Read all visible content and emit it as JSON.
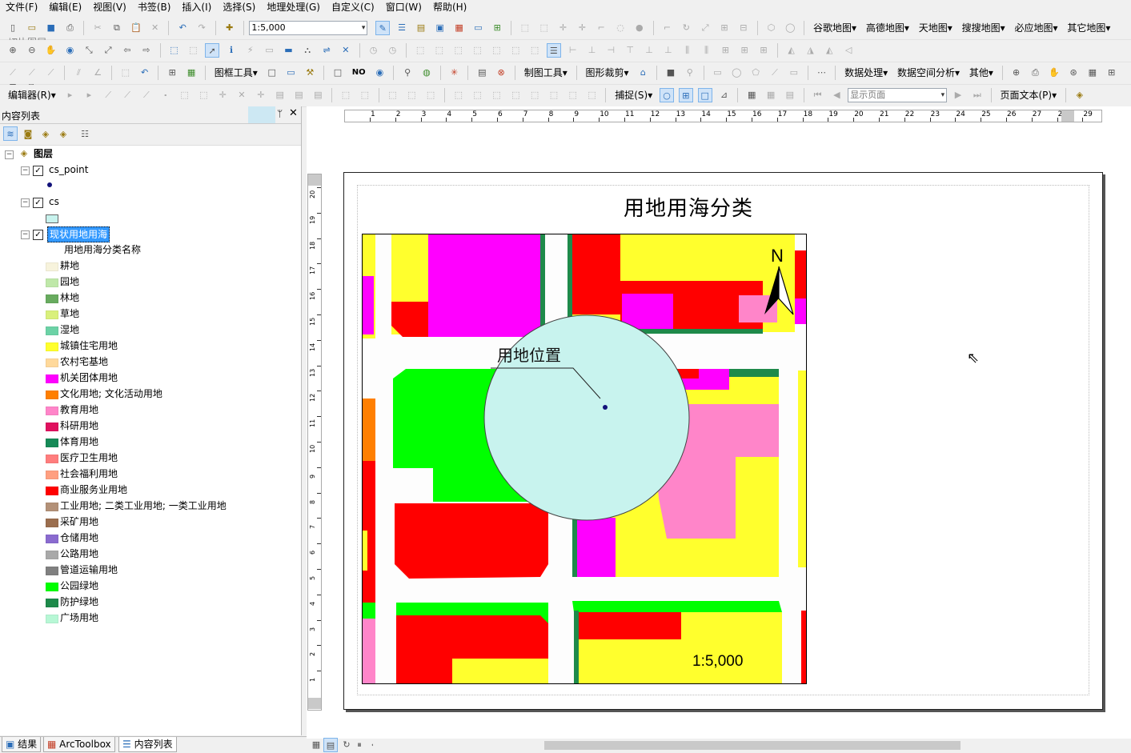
{
  "menu": [
    "文件(F)",
    "编辑(E)",
    "视图(V)",
    "书签(B)",
    "插入(I)",
    "选择(S)",
    "地理处理(G)",
    "自定义(C)",
    "窗口(W)",
    "帮助(H)"
  ],
  "toolbar": {
    "scale_value": "1:5,000",
    "basemaps": [
      "谷歌地图",
      "高德地图",
      "天地图",
      "搜搜地图",
      "必应地图",
      "其它地图",
      "切片图层"
    ],
    "row3_labels": [
      "图框工具",
      "NO",
      "制图工具",
      "图形裁剪",
      "数据处理",
      "数据空间分析",
      "其他"
    ],
    "editor_label": "编辑器(R)",
    "snapping_label": "捕捉(S)",
    "page_combo": "显示页面",
    "page_text": "页面文本(P)"
  },
  "toc": {
    "title": "内容列表",
    "root": "图层",
    "layers": [
      {
        "name": "cs_point",
        "checked": true,
        "symbol": "point"
      },
      {
        "name": "cs",
        "checked": true,
        "symbol": "#c8f3ee"
      },
      {
        "name": "现状用地用海",
        "checked": true,
        "selected": true,
        "field": "用地用海分类名称"
      }
    ],
    "legend": [
      {
        "label": "耕地",
        "color": "#f7f3dc"
      },
      {
        "label": "园地",
        "color": "#bfe8a9"
      },
      {
        "label": "林地",
        "color": "#68ab5f"
      },
      {
        "label": "草地",
        "color": "#d9f07c"
      },
      {
        "label": "湿地",
        "color": "#6cd2a6"
      },
      {
        "label": "城镇住宅用地",
        "color": "#ffff2d"
      },
      {
        "label": "农村宅基地",
        "color": "#ffd99b"
      },
      {
        "label": "机关团体用地",
        "color": "#ff00ff"
      },
      {
        "label": "文化用地; 文化活动用地",
        "color": "#ff7f00"
      },
      {
        "label": "教育用地",
        "color": "#ff85c9"
      },
      {
        "label": "科研用地",
        "color": "#e0115f"
      },
      {
        "label": "体育用地",
        "color": "#168a57"
      },
      {
        "label": "医疗卫生用地",
        "color": "#ff7d7d"
      },
      {
        "label": "社会福利用地",
        "color": "#ff9f80"
      },
      {
        "label": "商业服务业用地",
        "color": "#ff0000"
      },
      {
        "label": "工业用地; 二类工业用地; 一类工业用地",
        "color": "#b39178"
      },
      {
        "label": "采矿用地",
        "color": "#9b6e4e"
      },
      {
        "label": "仓储用地",
        "color": "#8a6bcf"
      },
      {
        "label": "公路用地",
        "color": "#a9a9a9"
      },
      {
        "label": "管道运输用地",
        "color": "#808080"
      },
      {
        "label": "公园绿地",
        "color": "#00ff00"
      },
      {
        "label": "防护绿地",
        "color": "#1e8a4a"
      },
      {
        "label": "广场用地",
        "color": "#b7f7d5"
      }
    ]
  },
  "bottom_tabs": [
    "结果",
    "ArcToolbox",
    "内容列表"
  ],
  "layout": {
    "title": "用地用海分类",
    "label": "用地位置",
    "north": "N",
    "scale_text": "1:5,000",
    "ruler_h": [
      "1",
      "2",
      "3",
      "4",
      "5",
      "6",
      "7",
      "8",
      "9",
      "10",
      "11",
      "12",
      "13",
      "14",
      "15",
      "16",
      "17",
      "18",
      "19",
      "20",
      "21",
      "22",
      "23",
      "24",
      "25",
      "26",
      "27",
      "28",
      "29"
    ],
    "ruler_v": [
      "20",
      "19",
      "18",
      "17",
      "16",
      "15",
      "14",
      "13",
      "12",
      "11",
      "10",
      "9",
      "8",
      "7",
      "6",
      "5",
      "4",
      "3",
      "2",
      "1"
    ]
  }
}
